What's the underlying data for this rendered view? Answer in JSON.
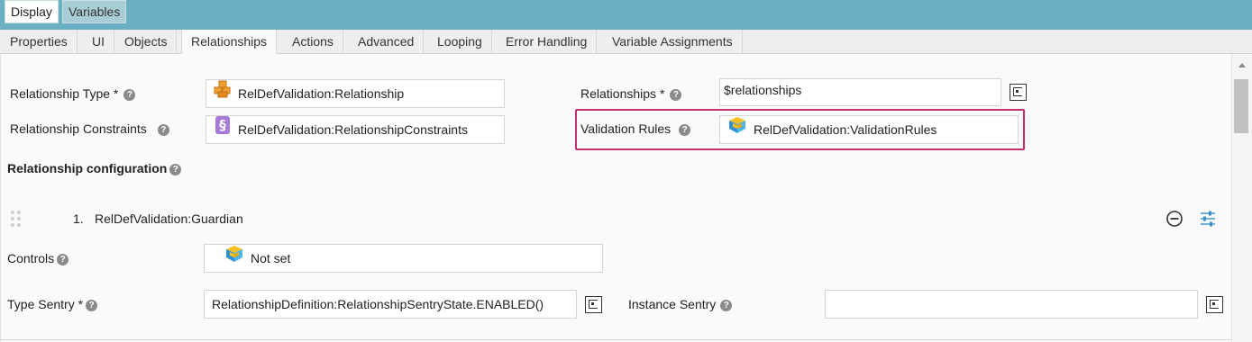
{
  "top_tabs": [
    {
      "label": "Display",
      "active": true
    },
    {
      "label": "Variables",
      "active": false
    }
  ],
  "tabs": [
    {
      "label": "Properties"
    },
    {
      "label": "UI"
    },
    {
      "label": "Objects"
    },
    {
      "label": "Relationships",
      "active": true
    },
    {
      "label": "Actions"
    },
    {
      "label": "Advanced"
    },
    {
      "label": "Looping"
    },
    {
      "label": "Error Handling"
    },
    {
      "label": "Variable Assignments"
    }
  ],
  "form": {
    "relationship_type_label": "Relationship Type *",
    "relationship_type_value": "RelDefValidation:Relationship",
    "relationship_constraints_label": "Relationship Constraints",
    "relationship_constraints_value": "RelDefValidation:RelationshipConstraints",
    "relationships_label": "Relationships *",
    "relationships_value": "$relationships",
    "validation_rules_label": "Validation Rules",
    "validation_rules_value": "RelDefValidation:ValidationRules"
  },
  "config": {
    "title": "Relationship configuration",
    "item_number": "1.",
    "item_name": "RelDefValidation:Guardian",
    "controls_label": "Controls",
    "controls_value": "Not set",
    "type_sentry_label": "Type Sentry *",
    "type_sentry_value": "RelationshipDefinition:RelationshipSentryState.ENABLED()",
    "instance_sentry_label": "Instance Sentry",
    "instance_sentry_value": ""
  },
  "help_glyph": "?",
  "colors": {
    "topbar": "#6ab0c2",
    "highlight": "#c3306f",
    "accent_blue": "#3a8fc7"
  }
}
